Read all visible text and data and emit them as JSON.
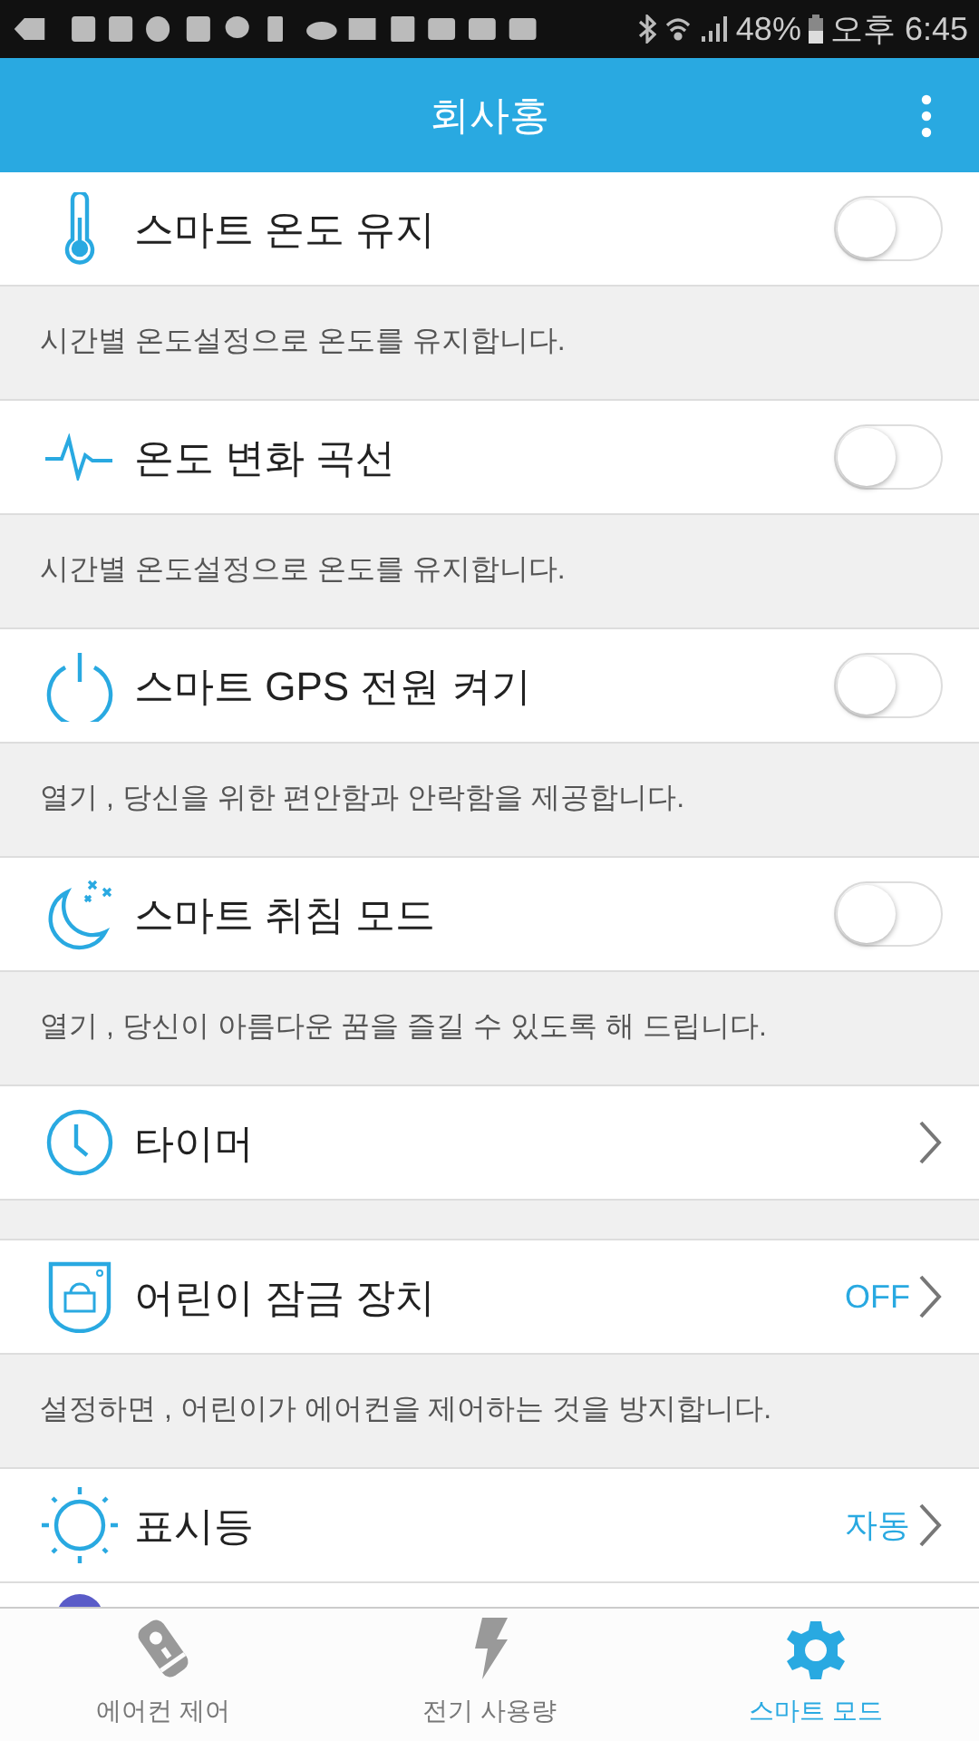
{
  "status_bar": {
    "battery": "48%",
    "time": "오후 6:45"
  },
  "header": {
    "title": "회사홍"
  },
  "items": [
    {
      "kind": "toggle",
      "label": "스마트 온도 유지",
      "on": false,
      "description": "시간별 온도설정으로 온도를 유지합니다."
    },
    {
      "kind": "toggle",
      "label": "온도 변화 곡선",
      "on": false,
      "description": "시간별 온도설정으로 온도를 유지합니다."
    },
    {
      "kind": "toggle",
      "label": "스마트 GPS 전원 켜기",
      "on": false,
      "description": "열기 , 당신을 위한 편안함과 안락함을 제공합니다."
    },
    {
      "kind": "toggle",
      "label": "스마트 취침 모드",
      "on": false,
      "description": "열기 , 당신이 아름다운 꿈을 즐길 수 있도록 해 드립니다."
    },
    {
      "kind": "link",
      "label": "타이머"
    },
    {
      "kind": "link",
      "label": "어린이 잠금 장치",
      "value": "OFF",
      "description": "설정하면 , 어린이가 에어컨을 제어하는 것을 방지합니다."
    },
    {
      "kind": "link",
      "label": "표시등",
      "value": "자동"
    },
    {
      "kind": "clipped"
    }
  ],
  "tabs": [
    {
      "label": "에어컨 제어",
      "selected": false
    },
    {
      "label": "전기 사용량",
      "selected": false
    },
    {
      "label": "스마트 모드",
      "selected": true
    }
  ]
}
